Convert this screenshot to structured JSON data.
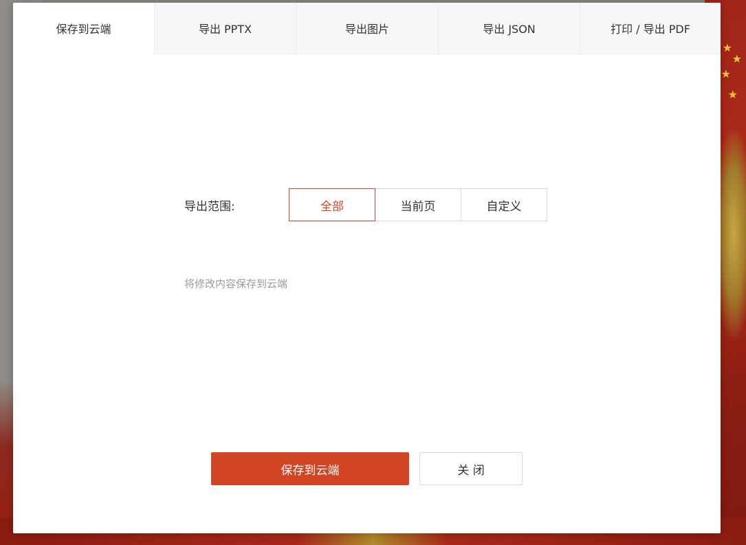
{
  "tabs": [
    {
      "label": "保存到云端",
      "active": true
    },
    {
      "label": "导出 PPTX",
      "active": false
    },
    {
      "label": "导出图片",
      "active": false
    },
    {
      "label": "导出 JSON",
      "active": false
    },
    {
      "label": "打印 / 导出 PDF",
      "active": false
    }
  ],
  "range": {
    "label": "导出范围:",
    "options": [
      "全部",
      "当前页",
      "自定义"
    ],
    "selected": "全部"
  },
  "hint": "将修改内容保存到云端",
  "buttons": {
    "primary": "保存到云端",
    "close": "关 闭"
  },
  "colors": {
    "accent": "#d14424",
    "border": "#d9d9d9",
    "hint_text": "#9a9a9a"
  }
}
